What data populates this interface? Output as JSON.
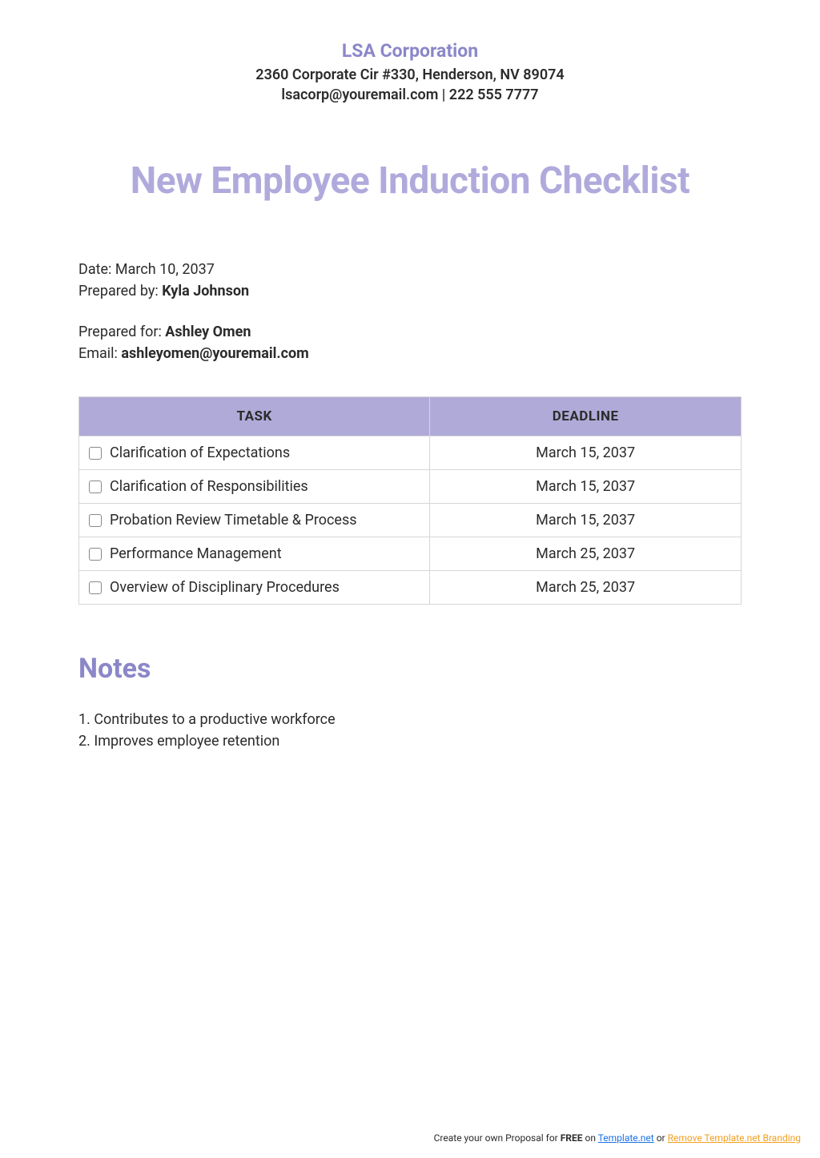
{
  "header": {
    "company_name": "LSA Corporation",
    "address": "2360 Corporate Cir #330, Henderson, NV 89074",
    "contact": "lsacorp@youremail.com | 222 555 7777"
  },
  "title": "New Employee Induction Checklist",
  "meta": {
    "date_label": "Date: ",
    "date_value": "March 10, 2037",
    "prepared_by_label": "Prepared by: ",
    "prepared_by_value": "Kyla Johnson",
    "prepared_for_label": "Prepared for: ",
    "prepared_for_value": "Ashley Omen",
    "email_label": "Email: ",
    "email_value": "ashleyomen@youremail.com"
  },
  "table": {
    "headers": {
      "task": "TASK",
      "deadline": "DEADLINE"
    },
    "rows": [
      {
        "task": "Clarification of Expectations",
        "deadline": "March 15, 2037"
      },
      {
        "task": "Clarification of Responsibilities",
        "deadline": "March 15, 2037"
      },
      {
        "task": "Probation Review Timetable & Process",
        "deadline": "March 15, 2037"
      },
      {
        "task": "Performance Management",
        "deadline": "March 25, 2037"
      },
      {
        "task": "Overview of Disciplinary Procedures",
        "deadline": "March 25, 2037"
      }
    ]
  },
  "notes": {
    "heading": "Notes",
    "items": [
      "1. Contributes to a productive workforce",
      "2. Improves employee retention"
    ]
  },
  "footer": {
    "prefix": "Create your own Proposal for ",
    "free": "FREE",
    "on": " on    ",
    "link1": "Template.net",
    "or": "  or  ",
    "link2": "Remove Template.net Branding"
  }
}
